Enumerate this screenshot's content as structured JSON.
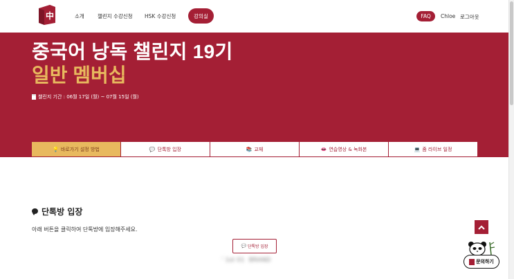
{
  "header": {
    "logo_alt": "中",
    "nav": [
      {
        "label": "소개"
      },
      {
        "label": "챌린지 수강신청"
      },
      {
        "label": "HSK 수강신청"
      }
    ],
    "classroom_label": "강의실",
    "faq_label": "FAQ",
    "user_name": "Chloe",
    "logout_label": "로그아웃"
  },
  "hero": {
    "title": "중국어 낭독 챌린지 19기",
    "subtitle": "일반 멤버십",
    "period_icon": "calendar-icon",
    "period": "챌린지 기간 : 06월 17일 (월) ~ 07월 15일 (월)"
  },
  "tabs": [
    {
      "icon": "💡",
      "label": "바로가기 설정 방법",
      "active": true
    },
    {
      "icon": "💬",
      "label": "단톡방 입장",
      "active": false
    },
    {
      "icon": "📚",
      "label": "교재",
      "active": false
    },
    {
      "icon": "👄",
      "label": "연습영상 & 녹화본",
      "active": false
    },
    {
      "icon": "💻",
      "label": "줌 라이브 일정",
      "active": false
    }
  ],
  "content": {
    "section_title": "단톡방 입장",
    "description": "아래 버튼을 클릭하여 단톡방에 입장해주세요.",
    "chat_button_label": "단톡방 입장",
    "blurred": [
      "' 1st 01",
      "BRAND"
    ]
  },
  "floating": {
    "inquiry_label": "문의하기"
  },
  "colors": {
    "brand": "#a41f35",
    "gold": "#e8b95e"
  }
}
